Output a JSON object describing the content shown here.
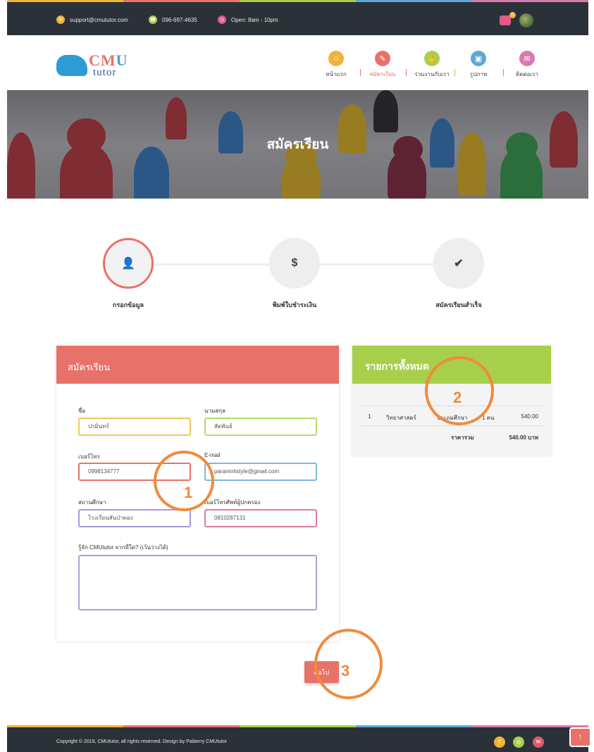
{
  "topbar": {
    "email": "support@cmututor.com",
    "phone": "096-697-4635",
    "hours": "Open: 8am - 10pm",
    "cart_count": "0"
  },
  "logo": {
    "cmu_c": "CM",
    "cmu_u": "U",
    "tutor": "tutor"
  },
  "nav": {
    "items": [
      {
        "label": "หน้าแรก",
        "icon": "home-icon",
        "color": "#f0b33c"
      },
      {
        "label": "สมัครเรียน",
        "icon": "pencil-icon",
        "color": "#e8726a"
      },
      {
        "label": "ร่วมงานกับเรา",
        "icon": "handshake-icon",
        "color": "#a7cf4b"
      },
      {
        "label": "รูปภาพ",
        "icon": "image-icon",
        "color": "#5aa9d6"
      },
      {
        "label": "ติดต่อเรา",
        "icon": "mail-icon",
        "color": "#d97ab0"
      }
    ]
  },
  "banner": {
    "title": "สมัครเรียน"
  },
  "steps": [
    {
      "label": "กรอกข้อมูล",
      "icon": "user-icon",
      "glyph": "👤"
    },
    {
      "label": "พิมพ์ใบชำระเงิน",
      "icon": "dollar-icon",
      "glyph": "$"
    },
    {
      "label": "สมัครเรียนสำเร็จ",
      "icon": "check-icon",
      "glyph": "✔"
    }
  ],
  "form": {
    "title": "สมัครเรียน",
    "first_name_label": "ชื่อ",
    "first_name_value": "ปรมินทร์",
    "last_name_label": "นามสกุล",
    "last_name_value": "สัตพันธ์",
    "phone_label": "เบอร์โทร",
    "phone_value": "0998134777",
    "email_label": "E-mail",
    "email_value": "paramintstyle@gmail.com",
    "school_label": "สถานศึกษา",
    "school_value": "โรงเรียนสันป่าตอง",
    "parent_phone_label": "เบอร์โทรศัพท์ผู้ปกครอง",
    "parent_phone_value": "0810287131",
    "source_label": "รู้จัก CMUtutor จากที่ใด? (เว้นว่างได้)"
  },
  "summary": {
    "title": "รายการทั้งหมด",
    "row": {
      "no": "1",
      "subject": "วิทยาศาสตร์",
      "level": "ประถมศึกษา",
      "people": "1 คน",
      "price": "540.00"
    },
    "total_label": "ราคารวม",
    "total_value": "540.00 บาท"
  },
  "next_label": "ต่อไป",
  "annotations": [
    "1",
    "2",
    "3"
  ],
  "footer": {
    "copyright": "Copyright © 2019, CMUtutor, all rights reserved. Design by Paiberry CMUtutor",
    "to_top": "↑"
  }
}
